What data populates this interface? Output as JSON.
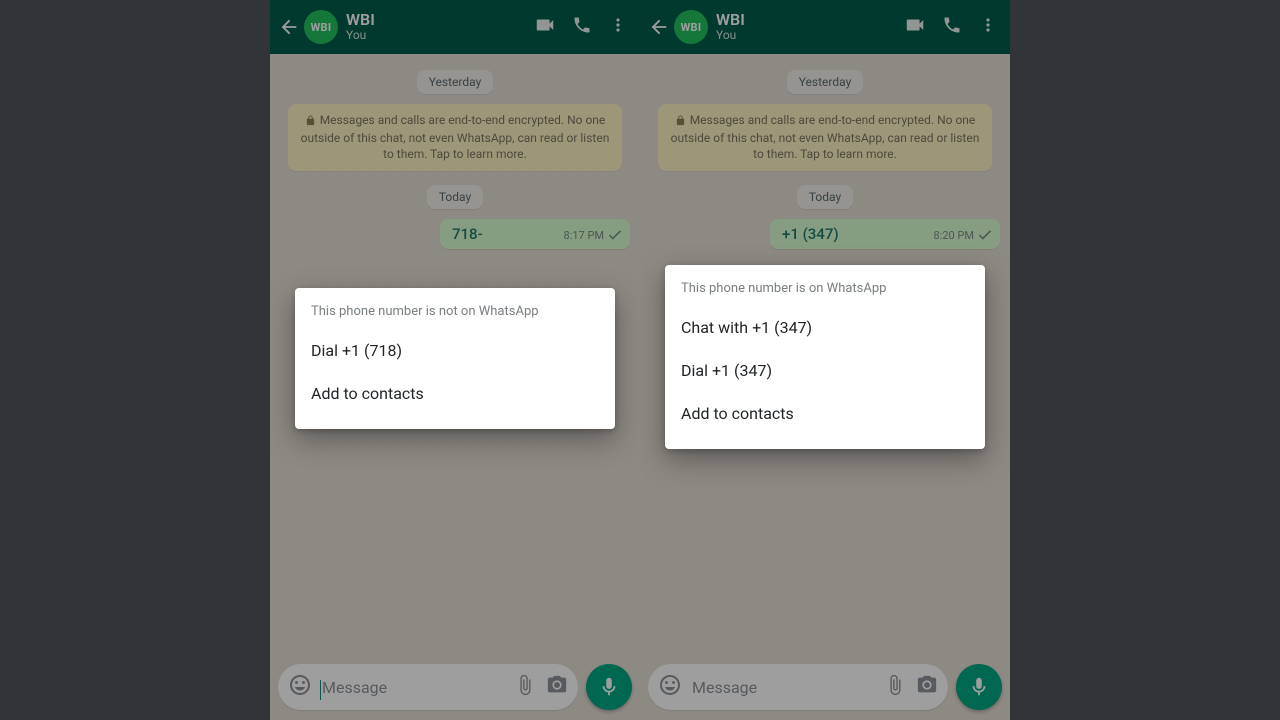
{
  "header": {
    "title": "WBI",
    "subtitle": "You",
    "avatar_text": "WBI"
  },
  "chat": {
    "date_yesterday": "Yesterday",
    "date_today": "Today",
    "e2ee": "Messages and calls are end-to-end encrypted. No one outside of this chat, not even WhatsApp, can read or listen to them. Tap to learn more."
  },
  "left": {
    "message_text": "718-",
    "message_time": "8:17 PM",
    "popup_title": "This phone number is not on WhatsApp",
    "popup_item_dial": "Dial +1 (718)",
    "popup_item_add": "Add to contacts"
  },
  "right": {
    "message_text": "+1 (347)",
    "message_time": "8:20 PM",
    "popup_title": "This phone number is on WhatsApp",
    "popup_item_chat": "Chat with +1 (347)",
    "popup_item_dial": "Dial +1 (347)",
    "popup_item_add": "Add to contacts"
  },
  "input": {
    "placeholder": "Message"
  }
}
